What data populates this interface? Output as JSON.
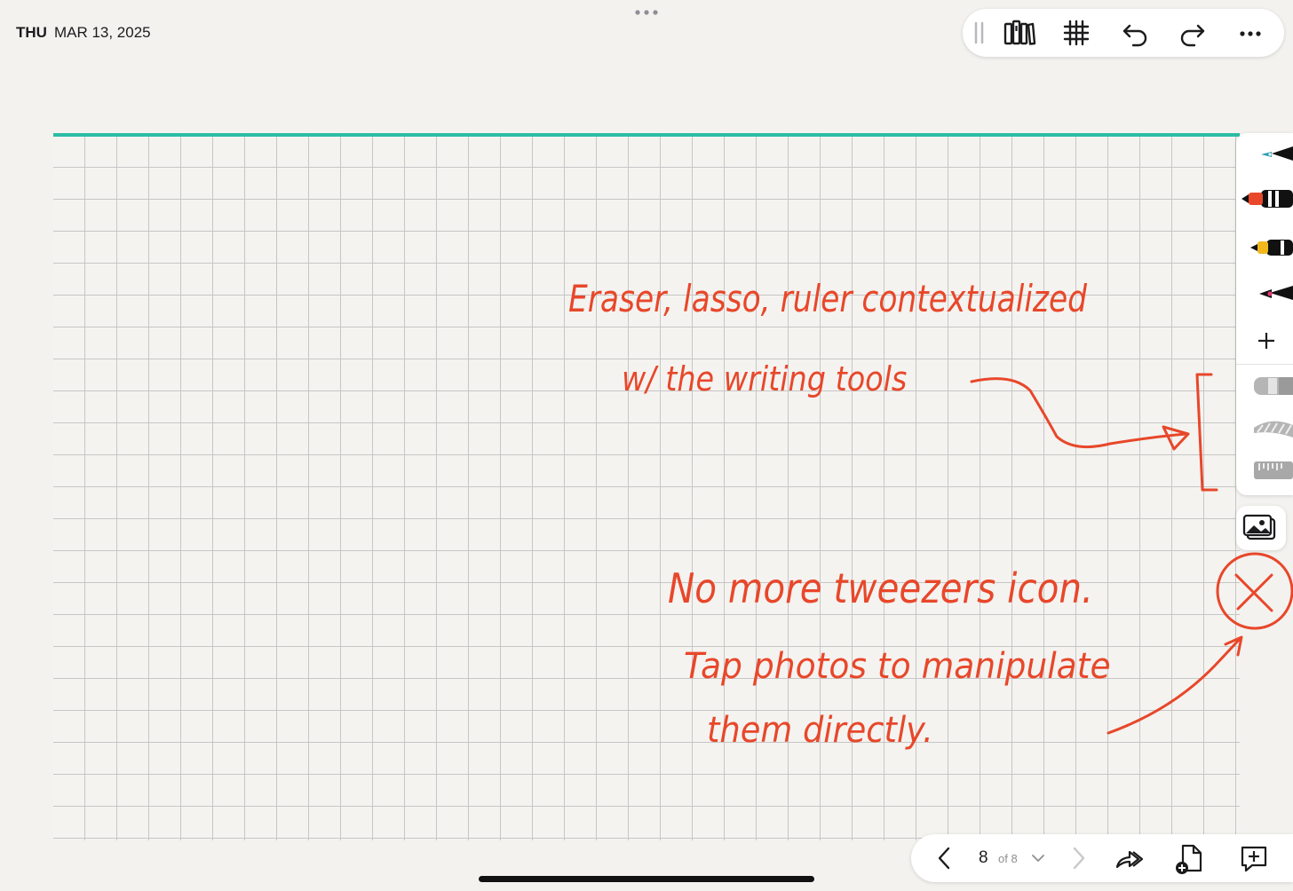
{
  "header": {
    "day": "THU",
    "date": "MAR 13, 2025"
  },
  "toolbar": {
    "icons": [
      "drag-handle-icon",
      "library-icon",
      "grid-icon",
      "undo-icon",
      "redo-icon",
      "more-icon"
    ]
  },
  "side_tools": {
    "pens": [
      "fountain-pen-teal",
      "pen-orange",
      "pen-yellow",
      "fountain-pen-pink"
    ],
    "add_label": "+",
    "tools": [
      "eraser-icon",
      "lasso-icon",
      "ruler-icon"
    ],
    "media": "photos-icon"
  },
  "pager": {
    "current": "8",
    "of_label": "of 8"
  },
  "annotations": {
    "line1": "Eraser, lasso, ruler contextualized",
    "line2": "w/ the writing tools",
    "line3": "No more tweezers icon.",
    "line4": "Tap photos to manipulate",
    "line5": "them directly."
  },
  "colors": {
    "accent_line": "#2bbca5",
    "ink": "#e8472a",
    "paper": "#f3f2ef",
    "grid": "#c6c6c6"
  }
}
